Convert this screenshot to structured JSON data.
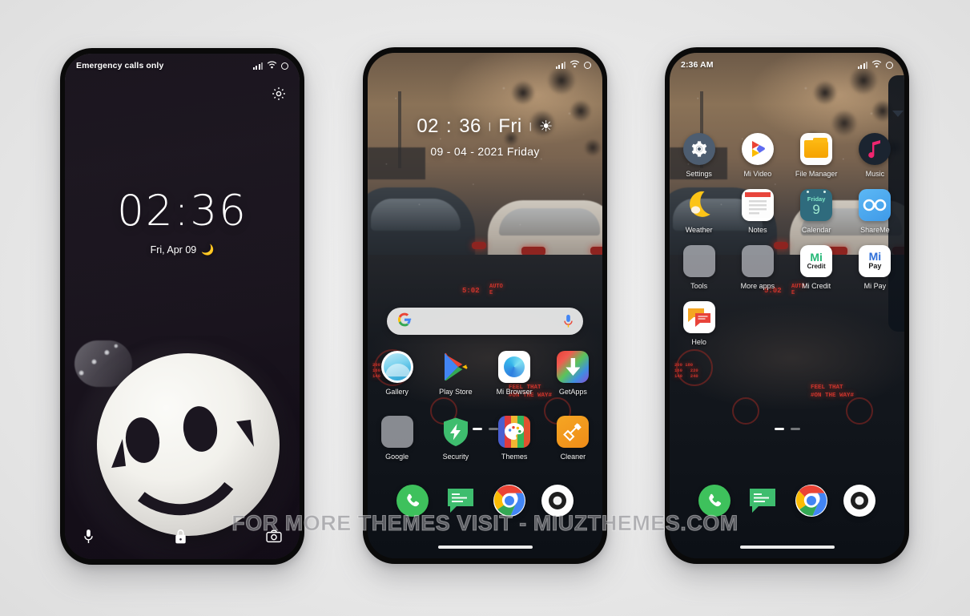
{
  "canvas": {
    "background": "#e8e8e8",
    "watermark": "FOR MORE THEMES VISIT - MIUZTHEMES.COM"
  },
  "lockscreen": {
    "statusbar": {
      "left": "Emergency calls only",
      "signal_icon": "signal-bars-icon",
      "wifi_icon": "wifi-icon",
      "battery_icon": "battery-icon"
    },
    "gear_icon": "gear-icon",
    "time": "02:36",
    "date": "Fri, Apr 09",
    "weather_glyph": "🌙",
    "bottom": {
      "mic": "microphone-icon",
      "lock": "lock-icon",
      "camera": "camera-icon"
    }
  },
  "homescreen": {
    "statusbar": {
      "left": "",
      "signal_icon": "signal-bars-icon",
      "wifi_icon": "wifi-icon",
      "battery_icon": "battery-icon"
    },
    "widget": {
      "hours": "02",
      "colon": ":",
      "minutes": "36",
      "weekday": "Fri",
      "sun_glyph": "☀",
      "sep": "|",
      "date": "09 - 04 - 2021 Friday"
    },
    "search": {
      "logo": "G",
      "placeholder": "",
      "mic_icon": "mic-icon"
    },
    "row1": [
      {
        "label": "Gallery",
        "icon": "gallery-icon"
      },
      {
        "label": "Play Store",
        "icon": "play-store-icon"
      },
      {
        "label": "Mi Browser",
        "icon": "mi-browser-icon"
      },
      {
        "label": "GetApps",
        "icon": "getapps-icon"
      }
    ],
    "row2": [
      {
        "label": "Google",
        "icon": "google-folder-icon"
      },
      {
        "label": "Security",
        "icon": "security-icon"
      },
      {
        "label": "Themes",
        "icon": "themes-icon"
      },
      {
        "label": "Cleaner",
        "icon": "cleaner-icon"
      }
    ],
    "dock": [
      {
        "label": "Phone",
        "icon": "phone-icon"
      },
      {
        "label": "Messages",
        "icon": "messages-icon"
      },
      {
        "label": "Chrome",
        "icon": "chrome-icon"
      },
      {
        "label": "Camera",
        "icon": "camera-icon"
      }
    ],
    "page_indicator": {
      "total": 2,
      "active": 1
    }
  },
  "appsscreen": {
    "statusbar": {
      "left": "2:36 AM",
      "signal_icon": "signal-bars-icon",
      "wifi_icon": "wifi-icon",
      "battery_icon": "battery-icon"
    },
    "apps": [
      {
        "label": "Settings",
        "icon": "settings-icon"
      },
      {
        "label": "Mi Video",
        "icon": "mi-video-icon"
      },
      {
        "label": "File Manager",
        "icon": "file-manager-icon"
      },
      {
        "label": "Music",
        "icon": "music-icon"
      },
      {
        "label": "Weather",
        "icon": "weather-icon"
      },
      {
        "label": "Notes",
        "icon": "notes-icon"
      },
      {
        "label": "Calendar",
        "icon": "calendar-icon"
      },
      {
        "label": "ShareMe",
        "icon": "shareme-icon"
      },
      {
        "label": "Tools",
        "icon": "tools-folder-icon"
      },
      {
        "label": "More apps",
        "icon": "more-apps-folder-icon"
      },
      {
        "label": "Mi Credit",
        "icon": "mi-credit-icon"
      },
      {
        "label": "Mi Pay",
        "icon": "mi-pay-icon"
      },
      {
        "label": "Helo",
        "icon": "helo-icon"
      }
    ],
    "calendar_badge": {
      "weekday": "Friday",
      "day": "9"
    },
    "mi_credit_text": {
      "top": "Mi",
      "bottom": "Credit"
    },
    "mi_pay_text": {
      "top": "Mi",
      "bottom": "Pay"
    },
    "dock": [
      {
        "label": "Phone",
        "icon": "phone-icon"
      },
      {
        "label": "Messages",
        "icon": "messages-icon"
      },
      {
        "label": "Chrome",
        "icon": "chrome-icon"
      },
      {
        "label": "Camera",
        "icon": "camera-icon"
      }
    ],
    "page_indicator": {
      "total": 2,
      "active": 1
    }
  }
}
